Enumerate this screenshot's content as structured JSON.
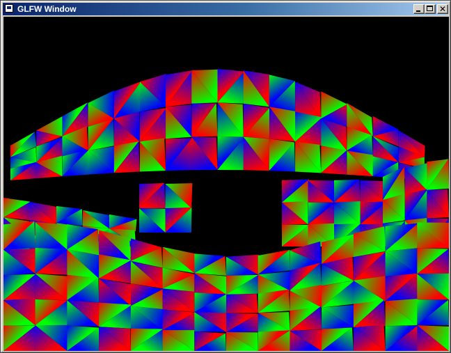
{
  "window": {
    "title": "GLFW Window",
    "icon": "app-window-icon",
    "controls": {
      "minimize": "minimize-icon",
      "maximize": "maximize-icon",
      "close_glyph": "✕"
    }
  },
  "scene": {
    "background": "#000000",
    "vertex_colors": [
      "#ff0000",
      "#00ff00",
      "#0000ff"
    ]
  }
}
